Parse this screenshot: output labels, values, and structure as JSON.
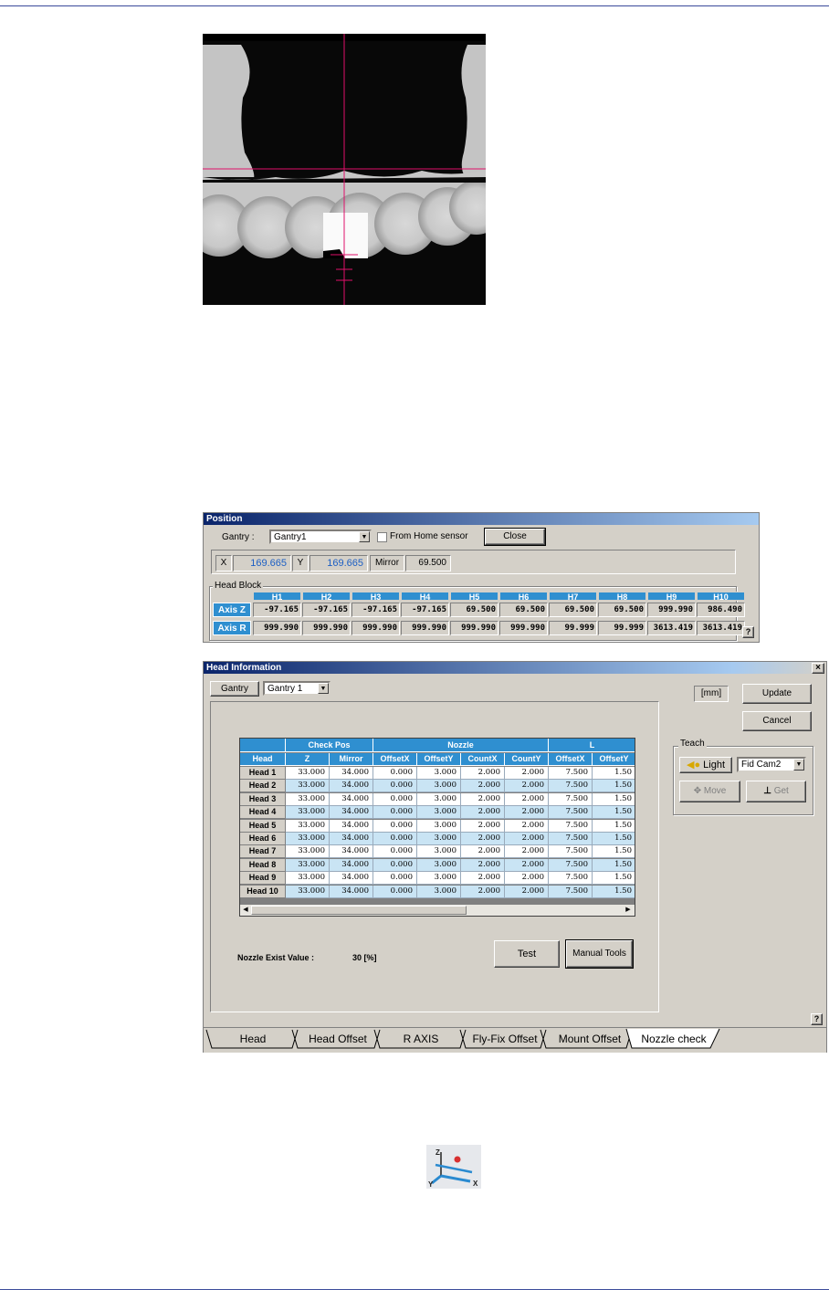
{
  "position_panel": {
    "title": "Position",
    "gantry_label": "Gantry :",
    "gantry_value": "Gantry1",
    "from_home_label": "From Home sensor",
    "close_label": "Close",
    "x_label": "X",
    "x_value": "169.665",
    "y_label": "Y",
    "y_value": "169.665",
    "mirror_label": "Mirror",
    "mirror_value": "69.500",
    "head_block_label": "Head Block",
    "heads": [
      "H1",
      "H2",
      "H3",
      "H4",
      "H5",
      "H6",
      "H7",
      "H8",
      "H9",
      "H10"
    ],
    "axis_z_label": "Axis Z",
    "axis_r_label": "Axis R",
    "axis_z": [
      "-97.165",
      "-97.165",
      "-97.165",
      "-97.165",
      "69.500",
      "69.500",
      "69.500",
      "69.500",
      "999.990",
      "986.490"
    ],
    "axis_r": [
      "999.990",
      "999.990",
      "999.990",
      "999.990",
      "999.990",
      "999.990",
      "99.999",
      "99.999",
      "3613.419",
      "3613.419"
    ],
    "help": "?"
  },
  "head_info": {
    "title": "Head Information",
    "close_glyph": "×",
    "gantry_tab": "Gantry",
    "gantry_value": "Gantry 1",
    "unit": "[mm]",
    "update_label": "Update",
    "cancel_label": "Cancel",
    "teach_label": "Teach",
    "light_label": "Light",
    "camera_value": "Fid Cam2",
    "move_label": "Move",
    "get_label": "Get",
    "grid": {
      "groups": [
        "Check Pos",
        "Nozzle",
        "L"
      ],
      "columns": [
        "Head",
        "Z",
        "Mirror",
        "OffsetX",
        "OffsetY",
        "CountX",
        "CountY",
        "OffsetX",
        "OffsetY"
      ],
      "rows": [
        [
          "Head 1",
          "33.000",
          "34.000",
          "0.000",
          "3.000",
          "2.000",
          "2.000",
          "7.500",
          "1.50"
        ],
        [
          "Head 2",
          "33.000",
          "34.000",
          "0.000",
          "3.000",
          "2.000",
          "2.000",
          "7.500",
          "1.50"
        ],
        [
          "Head 3",
          "33.000",
          "34.000",
          "0.000",
          "3.000",
          "2.000",
          "2.000",
          "7.500",
          "1.50"
        ],
        [
          "Head 4",
          "33.000",
          "34.000",
          "0.000",
          "3.000",
          "2.000",
          "2.000",
          "7.500",
          "1.50"
        ],
        [
          "Head 5",
          "33.000",
          "34.000",
          "0.000",
          "3.000",
          "2.000",
          "2.000",
          "7.500",
          "1.50"
        ],
        [
          "Head 6",
          "33.000",
          "34.000",
          "0.000",
          "3.000",
          "2.000",
          "2.000",
          "7.500",
          "1.50"
        ],
        [
          "Head 7",
          "33.000",
          "34.000",
          "0.000",
          "3.000",
          "2.000",
          "2.000",
          "7.500",
          "1.50"
        ],
        [
          "Head 8",
          "33.000",
          "34.000",
          "0.000",
          "3.000",
          "2.000",
          "2.000",
          "7.500",
          "1.50"
        ],
        [
          "Head 9",
          "33.000",
          "34.000",
          "0.000",
          "3.000",
          "2.000",
          "2.000",
          "7.500",
          "1.50"
        ],
        [
          "Head 10",
          "33.000",
          "34.000",
          "0.000",
          "3.000",
          "2.000",
          "2.000",
          "7.500",
          "1.50"
        ]
      ]
    },
    "nozzle_exist_label": "Nozzle Exist Value :",
    "nozzle_exist_value": "30 [%]",
    "test_label": "Test",
    "manual_tools_label": "Manual Tools",
    "help": "?",
    "tabs": [
      "Head",
      "Head Offset",
      "R AXIS",
      "Fly-Fix Offset",
      "Mount Offset",
      "Nozzle check"
    ],
    "active_tab": "Nozzle check"
  },
  "axis_icon": {
    "z": "Z",
    "y": "Y",
    "x": "X"
  }
}
